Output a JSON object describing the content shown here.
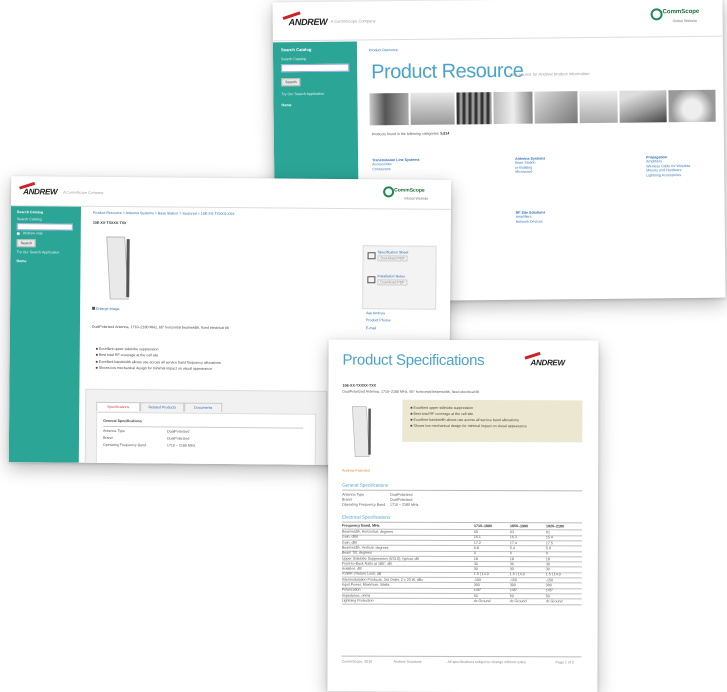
{
  "resource_page": {
    "brand": "ANDREW",
    "tagline": "A CommScope Company",
    "commscope": "CommScope",
    "commscope_sub": "Global Website",
    "sidebar": {
      "search_title": "Search Catalog",
      "search_hint": "Search Catalog",
      "search_button": "Search",
      "advanced": "Try Our Search Application",
      "home": "Home"
    },
    "breadcrumb": "Product Resource",
    "title": "Product Resource",
    "subtitle": "Your source for Andrew product information",
    "products_found_label": "Products found in the following categories:",
    "products_found_count": "5,814",
    "columns": [
      {
        "heading": "Transmission Line Systems",
        "items": [
          "Accessories",
          "Connectors"
        ]
      },
      {
        "heading": "Antenna Systems",
        "items": [
          "Base Station",
          "In-Building",
          "Microwave"
        ]
      },
      {
        "heading": "Propagation",
        "items": [
          "Amplifiers",
          "Wireless Cable for Wireless",
          "Mounts and Hardware",
          "Lightning Accessories"
        ]
      }
    ],
    "rf_section": {
      "heading": "RF Site Solutions",
      "items": [
        "Amplifiers",
        "Network Devices"
      ]
    }
  },
  "detail_page": {
    "brand": "ANDREW",
    "tagline": "A CommScope Company",
    "commscope": "CommScope",
    "commscope_sub": "Global Website",
    "sidebar": {
      "search_title": "Search Catalog",
      "search_hint": "Search Catalog",
      "radio_label": "Andrew only",
      "search_button": "Search",
      "advanced": "Try Our Search Application",
      "home": "Home"
    },
    "breadcrumb": "Product Resource > Antenna Systems > Base Station > Sectored > 10E-XX-TXXXX-XXX",
    "product_id": "10E-XX-TXXXX-TXX",
    "image_caption": "Enlarge Image",
    "description": "DualPolarized Antenna, 1710–2180 MHz, 65° horizontal beamwidth, fixed electrical tilt",
    "side_links": [
      "Specification Sheet",
      "Installation Notes",
      "Ask Andrew",
      "Product Photos",
      "E-mail"
    ],
    "side_links_sub": [
      "Download PDF",
      "Download PDF"
    ],
    "bullets": [
      "Excellent upper sidelobe suppression",
      "Best total RF coverage at the cell site",
      "Excellent bandwidth allows use across all service band frequency allocations",
      "Shows low mechanical design for minimal impact on visual appearance"
    ],
    "tabs": [
      "Specifications",
      "Related Products",
      "Documents"
    ],
    "table_title": "General Specifications",
    "rows": [
      {
        "label": "Antenna Type",
        "value": "DualPolarized"
      },
      {
        "label": "Brand",
        "value": "DualPolarized"
      },
      {
        "label": "Operating Frequency Band",
        "value": "1710 – 2180 MHz"
      }
    ]
  },
  "spec_page": {
    "title": "Product Specifications",
    "brand": "ANDREW",
    "product_id": "10E-XX-TXXXX-TXX",
    "description": "DualPolarized Antenna, 1710–2180 MHz, 65° horizontal beamwidth, fixed electrical tilt",
    "highlights": [
      "Excellent upper sidelobe suppression",
      "Best total RF coverage at the cell site",
      "Excellent bandwidth allows use across all service band allocations",
      "Shows low mechanical design for minimal impact on visual appearance"
    ],
    "orange_note": "Andrew Patented",
    "general_heading": "General Specifications",
    "general_rows": [
      {
        "label": "Antenna Type",
        "value": "DualPolarized"
      },
      {
        "label": "Brand",
        "value": "DualPolarized"
      },
      {
        "label": "Operating Frequency Band",
        "value": "1710 – 2180 MHz"
      }
    ],
    "electrical_heading": "Electrical Specifications",
    "electrical_header": [
      "Frequency Band, MHz",
      "1710–1880",
      "1850–1990",
      "1920–2180"
    ],
    "electrical_rows": [
      [
        "Beamwidth, Horizontal, degrees",
        "65",
        "63",
        "61"
      ],
      [
        "Gain, dBd",
        "15.1",
        "15.3",
        "15.4"
      ],
      [
        "Gain, dBi",
        "17.2",
        "17.4",
        "17.5"
      ],
      [
        "Beamwidth, Vertical, degrees",
        "5.8",
        "5.4",
        "5.0"
      ],
      [
        "Beam Tilt, degrees",
        "0",
        "0",
        "0"
      ],
      [
        "Upper Sidelobe Suppression (USLS), typical, dB",
        "18",
        "18",
        "18"
      ],
      [
        "Front-to-Back Ratio at 180°, dB",
        "30",
        "30",
        "30"
      ],
      [
        "Isolation, dB",
        "30",
        "30",
        "30"
      ],
      [
        "VSWR | Return Loss, dB",
        "1.5 | 14.0",
        "1.5 | 14.0",
        "1.5 | 14.0"
      ],
      [
        "Intermodulation Products, 3rd Order, 2 x 20 W, dBc",
        "-150",
        "-150",
        "-150"
      ],
      [
        "Input Power, Maximum, Watts",
        "300",
        "300",
        "300"
      ],
      [
        "Polarization",
        "±45°",
        "±45°",
        "±45°"
      ],
      [
        "Impedance, ohms",
        "50",
        "50",
        "50"
      ],
      [
        "Lightning Protection",
        "dc Ground",
        "dc Ground",
        "dc Ground"
      ]
    ],
    "footer_cols": [
      "CommScope, 2010",
      "Andrew Solutions",
      "All specifications subject to change without notice",
      "Page 1 of 2"
    ]
  }
}
